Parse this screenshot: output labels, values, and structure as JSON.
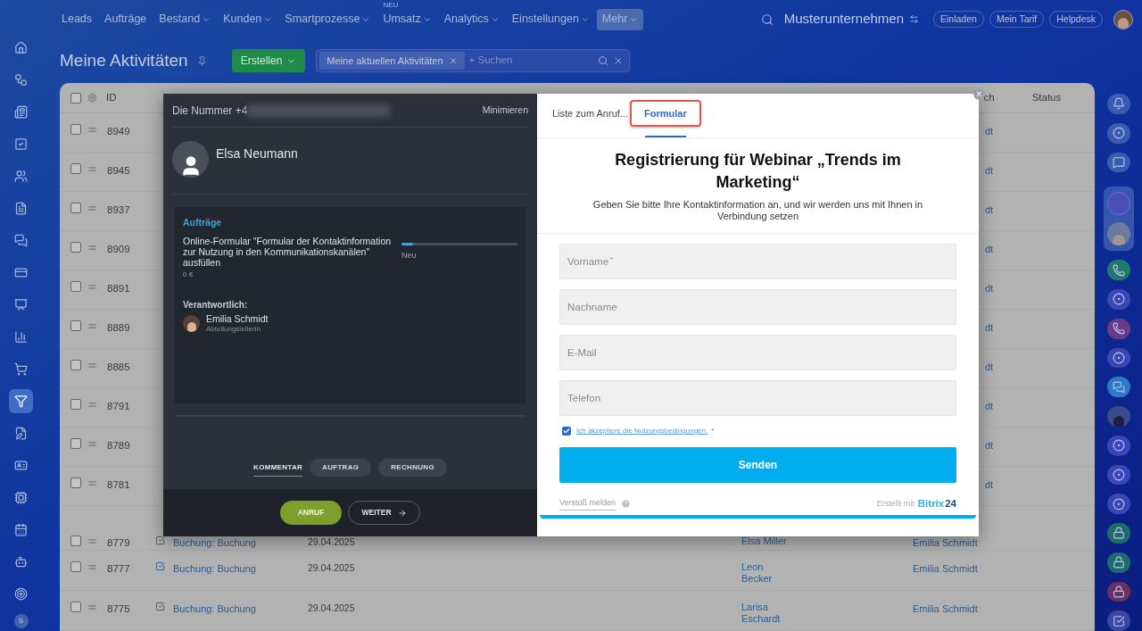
{
  "top_nav": {
    "items": [
      {
        "label": "Leads",
        "dropdown": false,
        "selected": false
      },
      {
        "label": "Aufträge",
        "dropdown": false,
        "selected": false
      },
      {
        "label": "Bestand",
        "dropdown": true,
        "selected": false
      },
      {
        "label": "Kunden",
        "dropdown": true,
        "selected": false
      },
      {
        "label": "Smartprozesse",
        "dropdown": true,
        "selected": false
      },
      {
        "label": "Umsatz",
        "dropdown": true,
        "selected": false,
        "badge": "NEU"
      },
      {
        "label": "Analytics",
        "dropdown": true,
        "selected": false
      },
      {
        "label": "Einstellungen",
        "dropdown": true,
        "selected": false
      },
      {
        "label": "Mehr",
        "dropdown": true,
        "selected": true
      }
    ],
    "company": "Musterunternehmen",
    "buttons": [
      "Einladen",
      "Mein Tarif",
      "Helpdesk"
    ]
  },
  "sidebar": {
    "items": [
      {
        "selected": false
      },
      {
        "selected": false
      },
      {
        "selected": false
      },
      {
        "selected": false
      },
      {
        "selected": false
      },
      {
        "selected": false
      },
      {
        "selected": false
      },
      {
        "selected": false
      },
      {
        "selected": false
      },
      {
        "selected": false
      },
      {
        "selected": false
      },
      {
        "selected": true
      },
      {
        "selected": false
      },
      {
        "selected": false
      },
      {
        "selected": false
      },
      {
        "selected": false
      },
      {
        "selected": false
      },
      {
        "selected": false
      }
    ],
    "user_initial": "S"
  },
  "header": {
    "title": "Meine Aktivitäten",
    "create_button": "Erstellen",
    "filter_tag": "Meine aktuellen Aktivitäten",
    "search_placeholder": "+ Suchen"
  },
  "table": {
    "select_all_checked": false,
    "columns": [
      "ID",
      "ch",
      "Status"
    ],
    "rows_partial": [
      {
        "checked": false,
        "id": "8949",
        "column_7": "dt"
      },
      {
        "checked": false,
        "id": "8945",
        "column_7": "dt"
      },
      {
        "checked": false,
        "id": "8937",
        "column_7": "dt"
      },
      {
        "checked": false,
        "id": "8909",
        "column_7": "dt"
      },
      {
        "checked": false,
        "id": "8891",
        "column_7": "dt"
      },
      {
        "checked": false,
        "id": "8889",
        "column_7": "dt"
      },
      {
        "checked": false,
        "id": "8885",
        "column_7": "dt"
      },
      {
        "checked": false,
        "id": "8791",
        "column_7": "dt"
      },
      {
        "checked": false,
        "id": "8789",
        "column_7": "dt"
      },
      {
        "checked": false,
        "id": "8781",
        "column_7": "dt"
      }
    ],
    "rows": [
      {
        "checked": false,
        "id": "8779",
        "title": "Buchung: Buchung",
        "date": "29.04.2025",
        "contact": [
          "Elsa Miller"
        ],
        "responsible": "Emilia Schmidt"
      },
      {
        "checked": false,
        "id": "8777",
        "title": "Buchung: Buchung",
        "date": "29.04.2025",
        "contact": [
          "Leon",
          "Becker"
        ],
        "responsible": "Emilia Schmidt"
      },
      {
        "checked": false,
        "id": "8775",
        "title": "Buchung: Buchung",
        "date": "29.04.2025",
        "contact": [
          "Larisa",
          "Eschardt"
        ],
        "responsible": "Emilia Schmidt"
      }
    ]
  },
  "call_panel": {
    "number_prefix": "Die Nummer +4",
    "minimize": "Minimieren",
    "contact_name": "Elsa Neumann",
    "deal": {
      "section": "Aufträge",
      "text": "Online-Formular \"Formular der Kontaktinformation zur Nutzung in den Kommunikationskanälen\" ausfüllen",
      "amount": "0 €",
      "level": 0.1,
      "stage": "Neu"
    },
    "responsible_label": "Verantwortlich:",
    "responsible_name": "Emilia Schmidt",
    "responsible_role": "Abteilungsleiterin",
    "tabs": [
      {
        "label": "KOMMENTAR",
        "selected": true
      },
      {
        "label": "AUFTRAG",
        "selected": false
      },
      {
        "label": "RECHNUNG",
        "selected": false
      }
    ],
    "call_button": "ANRUF",
    "next_button": "WEITER"
  },
  "form_panel": {
    "tabs": [
      {
        "label": "Liste zum Anruf...",
        "selected": false,
        "highlighted": false
      },
      {
        "label": "Formular",
        "selected": true,
        "highlighted": true
      }
    ],
    "title": "Registrierung für Webinar „Trends im Marketing“",
    "subtitle": "Geben Sie bitte Ihre Kontaktinformation an, und wir werden uns mit Ihnen in Verbindung setzen",
    "fields": [
      {
        "placeholder": "Vorname",
        "required_mark": "*"
      },
      {
        "placeholder": "Nachname"
      },
      {
        "placeholder": "E-Mail"
      },
      {
        "placeholder": "Telefon"
      }
    ],
    "consent": {
      "checked": true,
      "text": "Ich akzeptiere die Nutzungsbedingungen.",
      "required_mark": "*"
    },
    "submit": "Senden",
    "report": "Verstoß melden",
    "created_with": "Erstellt mit",
    "brand": "Bitrix",
    "brand_number": "24"
  },
  "close_symbol": "×"
}
